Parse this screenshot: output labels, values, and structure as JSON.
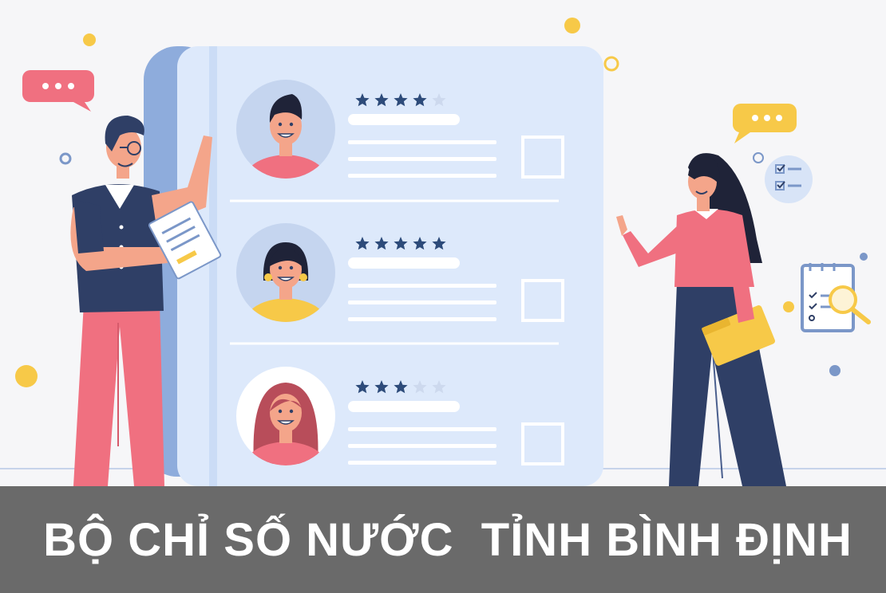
{
  "banner": {
    "title": "BỘ CHỈ SỐ NƯỚC  TỈNH BÌNH ĐỊNH"
  },
  "review_card": {
    "entries": [
      {
        "avatar": "man-avatar-icon",
        "rating": 4,
        "max_rating": 5
      },
      {
        "avatar": "woman-earrings-avatar-icon",
        "rating": 5,
        "max_rating": 5
      },
      {
        "avatar": "woman-long-hair-avatar-icon",
        "rating": 3,
        "max_rating": 5
      }
    ]
  },
  "colors": {
    "background": "#f6f6f8",
    "banner": "#6a6a6a",
    "card": "#dde9fb",
    "star": "#2d4b7a",
    "accent_pink": "#f07080",
    "accent_yellow": "#f7c948",
    "navy": "#2f3f66"
  },
  "icons": [
    "speech-bubble-icon",
    "checklist-icon",
    "clipboard-search-icon"
  ]
}
